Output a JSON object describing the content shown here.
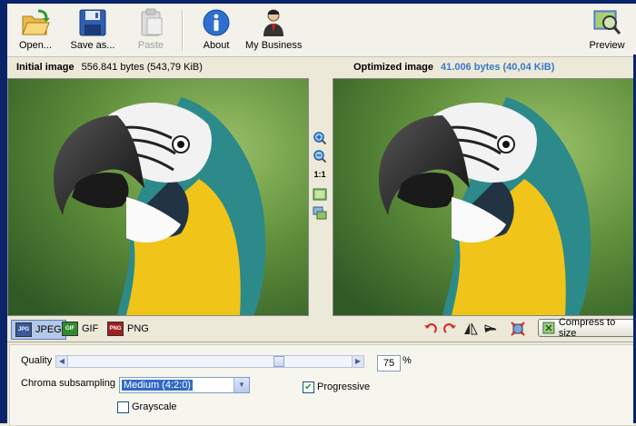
{
  "toolbar": {
    "open_label": "Open...",
    "saveas_label": "Save as...",
    "paste_label": "Paste",
    "about_label": "About",
    "mybusiness_label": "My Business",
    "preview_label": "Preview"
  },
  "initial": {
    "label": "Initial image",
    "size": "556.841 bytes (543,79 KiB)"
  },
  "optimized": {
    "label": "Optimized image",
    "size": "41.006 bytes (40,04 KiB)"
  },
  "zoom": {
    "one_to_one_label": "1:1"
  },
  "formats": [
    {
      "label": "JPEG",
      "icon": "JPG",
      "color": "#3a5a9a",
      "selected": true
    },
    {
      "label": "GIF",
      "icon": "GIF",
      "color": "#2e8b2e",
      "selected": false
    },
    {
      "label": "PNG",
      "icon": "PNG",
      "color": "#a02020",
      "selected": false
    }
  ],
  "compress_label": "Compress to size",
  "settings": {
    "quality_label": "Quality",
    "quality_value": "75",
    "quality_level": 0.75,
    "percent_label": "%",
    "chroma_label": "Chroma subsampling",
    "chroma_value": "Medium (4:2:0)",
    "progressive_label": "Progressive",
    "progressive_checked": true,
    "grayscale_label": "Grayscale",
    "grayscale_checked": false
  },
  "colors": {
    "accent_blue": "#3a78c8",
    "selection": "#316ac5"
  }
}
